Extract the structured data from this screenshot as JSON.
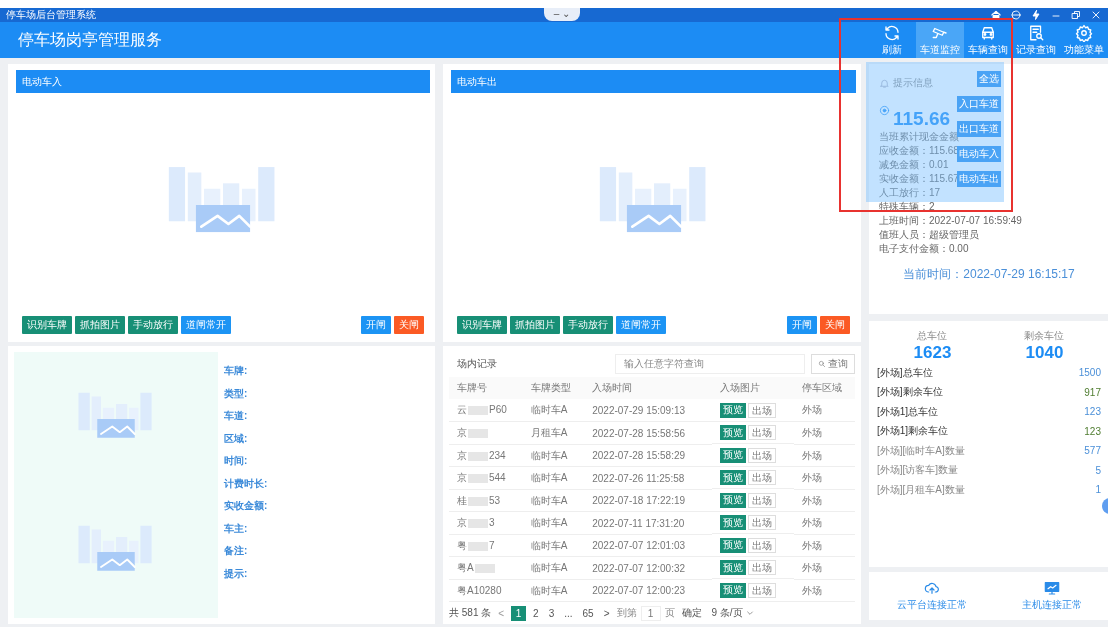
{
  "window": {
    "title": "停车场后台管理系统",
    "center_tab": "– ⌄"
  },
  "header": {
    "title": "停车场岗亭管理服务",
    "toolbar": [
      {
        "label": "刷新",
        "selected": false
      },
      {
        "label": "车道监控",
        "selected": true
      },
      {
        "label": "车辆查询",
        "selected": false
      },
      {
        "label": "记录查询",
        "selected": false
      },
      {
        "label": "功能菜单",
        "selected": false
      }
    ]
  },
  "lane_menu": {
    "expanded": true,
    "items": [
      "全选",
      "入口车道",
      "出口车道",
      "电动车入",
      "电动车出"
    ]
  },
  "lanes": [
    {
      "title": "电动车入",
      "buttons": [
        {
          "label": "识别车牌",
          "kind": "action"
        },
        {
          "label": "抓拍图片",
          "kind": "action"
        },
        {
          "label": "手动放行",
          "kind": "action"
        },
        {
          "label": "道闸常开",
          "kind": "info"
        }
      ],
      "gate_buttons": [
        {
          "label": "开闸",
          "kind": "open"
        },
        {
          "label": "关闸",
          "kind": "close"
        }
      ]
    },
    {
      "title": "电动车出",
      "buttons": [
        {
          "label": "识别车牌",
          "kind": "action"
        },
        {
          "label": "抓拍图片",
          "kind": "action"
        },
        {
          "label": "手动放行",
          "kind": "action"
        },
        {
          "label": "道闸常开",
          "kind": "info"
        }
      ],
      "gate_buttons": [
        {
          "label": "开闸",
          "kind": "open"
        },
        {
          "label": "关闸",
          "kind": "close"
        }
      ]
    }
  ],
  "vehicle_info": {
    "fields": [
      "车牌:",
      "类型:",
      "车道:",
      "区域:",
      "时间:",
      "计费时长:",
      "实收金额:",
      "车主:",
      "备注:",
      "提示:"
    ]
  },
  "records": {
    "title": "场内记录",
    "search": {
      "placeholder": "输入任意字符查询",
      "button": "查询"
    },
    "columns": [
      "车牌号",
      "车牌类型",
      "入场时间",
      "入场图片",
      "停车区域"
    ],
    "rows": [
      {
        "plate_head": "云",
        "plate_tail": "P60",
        "masked": true,
        "type": "临时车A",
        "time": "2022-07-29 15:09:13",
        "preview": "预览",
        "exit": "出场",
        "area": "外场"
      },
      {
        "plate_head": "京",
        "plate_tail": "",
        "masked": true,
        "type": "月租车A",
        "time": "2022-07-28 15:58:56",
        "preview": "预览",
        "exit": "出场",
        "area": "外场"
      },
      {
        "plate_head": "京",
        "plate_tail": "234",
        "masked": true,
        "type": "临时车A",
        "time": "2022-07-28 15:58:29",
        "preview": "预览",
        "exit": "出场",
        "area": "外场"
      },
      {
        "plate_head": "京",
        "plate_tail": "544",
        "masked": true,
        "type": "临时车A",
        "time": "2022-07-26 11:25:58",
        "preview": "预览",
        "exit": "出场",
        "area": "外场"
      },
      {
        "plate_head": "桂",
        "plate_tail": "53",
        "masked": true,
        "type": "临时车A",
        "time": "2022-07-18 17:22:19",
        "preview": "预览",
        "exit": "出场",
        "area": "外场"
      },
      {
        "plate_head": "京",
        "plate_tail": "3",
        "masked": true,
        "type": "临时车A",
        "time": "2022-07-11 17:31:20",
        "preview": "预览",
        "exit": "出场",
        "area": "外场"
      },
      {
        "plate_head": "粤",
        "plate_tail": "7",
        "masked": true,
        "type": "临时车A",
        "time": "2022-07-07 12:01:03",
        "preview": "预览",
        "exit": "出场",
        "area": "外场"
      },
      {
        "plate_head": "粤A",
        "plate_tail": "",
        "masked": true,
        "type": "临时车A",
        "time": "2022-07-07 12:00:32",
        "preview": "预览",
        "exit": "出场",
        "area": "外场"
      },
      {
        "plate_head": "粤A10280",
        "plate_tail": "",
        "masked": false,
        "type": "临时车A",
        "time": "2022-07-07 12:00:23",
        "preview": "预览",
        "exit": "出场",
        "area": "外场"
      }
    ],
    "pagination": {
      "total": "共 581 条",
      "prev": "<",
      "pages": [
        {
          "label": "1",
          "selected": true
        },
        {
          "label": "2",
          "selected": false
        },
        {
          "label": "3",
          "selected": false
        },
        {
          "label": "...",
          "selected": false
        },
        {
          "label": "65",
          "selected": false
        }
      ],
      "next": ">",
      "goto": "到第",
      "page_value": "1",
      "page_unit": "页",
      "confirm": "确定",
      "page_size": "9 条/页"
    }
  },
  "shift": {
    "title": "提示信息",
    "cash": "115.66",
    "cash_label": "当班累计现金金额",
    "lines": [
      "应收金额：115.68",
      "减免金额：0.01",
      "实收金额：115.67",
      "人工放行：17",
      "特殊车辆：2",
      "上班时间：2022-07-07 16:59:49",
      "值班人员：超级管理员",
      "电子支付金额：0.00"
    ],
    "current_time": "当前时间：2022-07-29 16:15:17"
  },
  "spaces": {
    "total_label": "总车位",
    "total": "1623",
    "free_label": "剩余车位",
    "free": "1040",
    "rows": [
      {
        "label": "[外场]总车位",
        "value": "1500",
        "kind": "total"
      },
      {
        "label": "[外场]剩余车位",
        "value": "917",
        "kind": "free"
      },
      {
        "label": "[外场1]总车位",
        "value": "123",
        "kind": "total"
      },
      {
        "label": "[外场1]剩余车位",
        "value": "123",
        "kind": "free"
      },
      {
        "label": "[外场][临时车A]数量",
        "value": "577",
        "kind": "count"
      },
      {
        "label": "[外场][访客车]数量",
        "value": "5",
        "kind": "count"
      },
      {
        "label": "[外场][月租车A]数量",
        "value": "1",
        "kind": "count"
      }
    ]
  },
  "status": [
    {
      "label": "云平台连接正常"
    },
    {
      "label": "主机连接正常"
    }
  ]
}
